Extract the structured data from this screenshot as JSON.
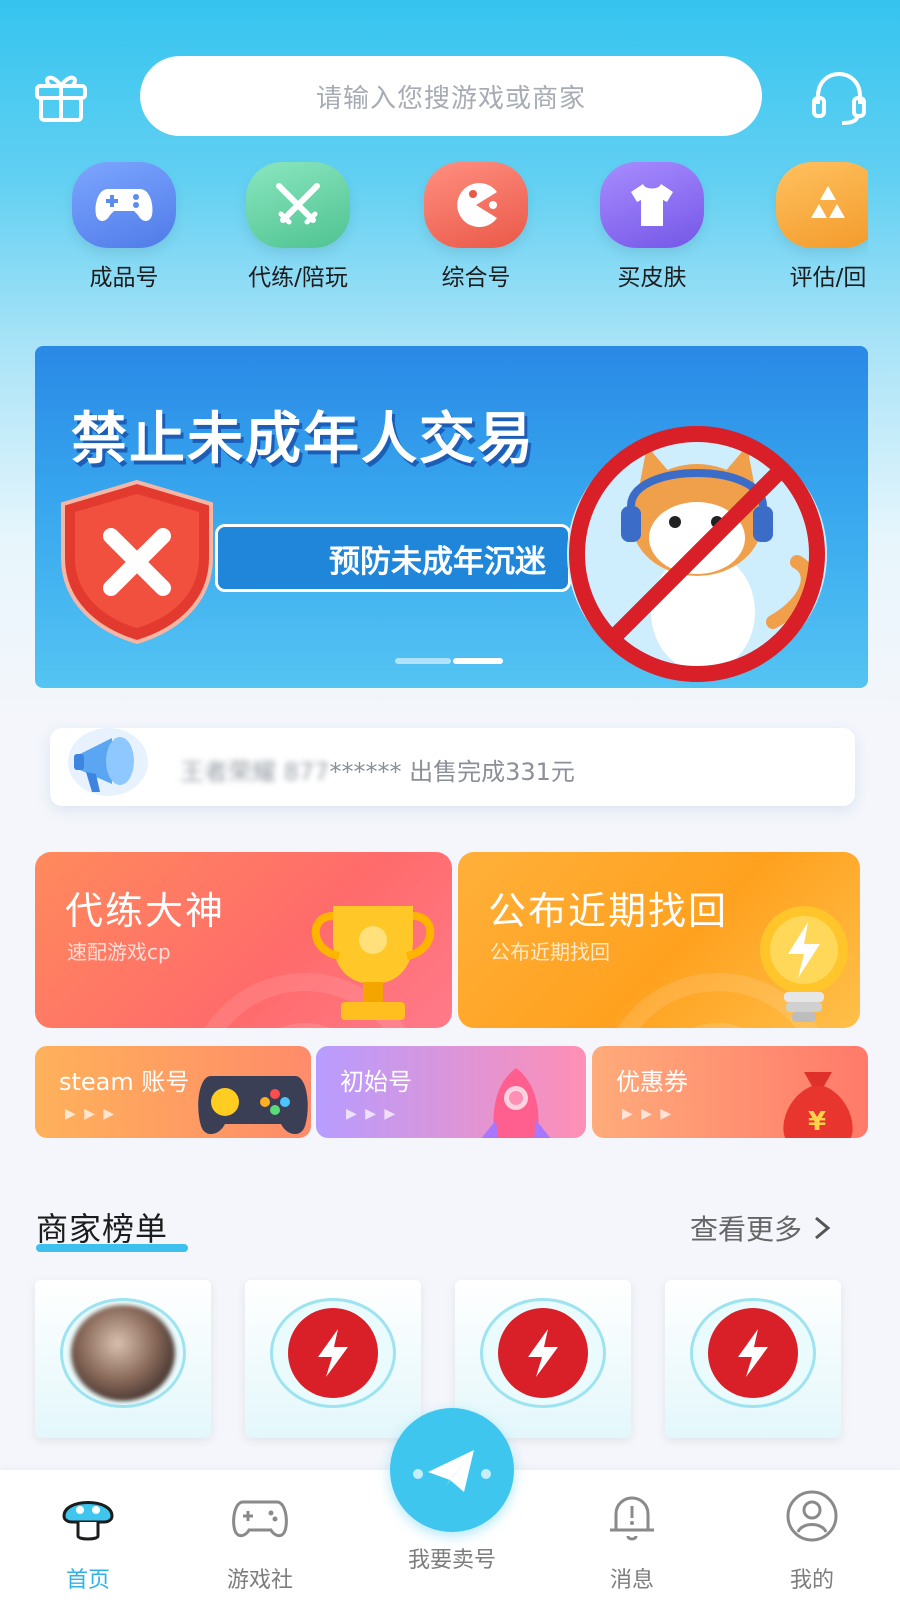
{
  "header": {
    "search_placeholder": "请输入您搜游戏或商家",
    "gift_icon": "gift-icon",
    "support_icon": "headset-icon"
  },
  "categories": [
    {
      "label": "成品号",
      "icon": "gamepad-icon",
      "color": "#5b8cf1"
    },
    {
      "label": "代练/陪玩",
      "icon": "swords-icon",
      "color": "#5ad0a2"
    },
    {
      "label": "综合号",
      "icon": "pacman-icon",
      "color": "#f26a5b"
    },
    {
      "label": "买皮肤",
      "icon": "tshirt-icon",
      "color": "#8a6cf0"
    },
    {
      "label": "评估/回",
      "icon": "recycle-icon",
      "color": "#f6a638"
    }
  ],
  "banner": {
    "title": "禁止未成年人交易",
    "subtitle": "预防未成年沉迷"
  },
  "notice": {
    "masked_prefix": "王者荣耀 877",
    "text": "****** 出售完成331元",
    "icon": "megaphone-icon"
  },
  "promos": {
    "big": [
      {
        "title": "代练大神",
        "subtitle": "速配游戏cp",
        "icon": "trophy-icon"
      },
      {
        "title": "公布近期找回",
        "subtitle": "公布近期找回",
        "icon": "lightbulb-icon"
      }
    ],
    "small": [
      {
        "title": "steam 账号",
        "arrows": "▶ ▶ ▶",
        "icon": "controller-icon"
      },
      {
        "title": "初始号",
        "arrows": "▶ ▶ ▶",
        "icon": "rocket-icon"
      },
      {
        "title": "优惠券",
        "arrows": "▶ ▶ ▶",
        "icon": "money-bag-icon"
      }
    ]
  },
  "ranking": {
    "title": "商家榜单",
    "more": "查看更多",
    "merchants": [
      {
        "type": "avatar"
      },
      {
        "type": "logo"
      },
      {
        "type": "logo"
      },
      {
        "type": "logo"
      }
    ]
  },
  "bottom_nav": {
    "items": [
      {
        "label": "首页",
        "active": true
      },
      {
        "label": "游戏社",
        "active": false
      },
      {
        "label": "我要卖号",
        "active": false
      },
      {
        "label": "消息",
        "active": false
      },
      {
        "label": "我的",
        "active": false
      }
    ]
  },
  "colors": {
    "accent": "#3ec6ef",
    "logo_red": "#d91f27"
  }
}
